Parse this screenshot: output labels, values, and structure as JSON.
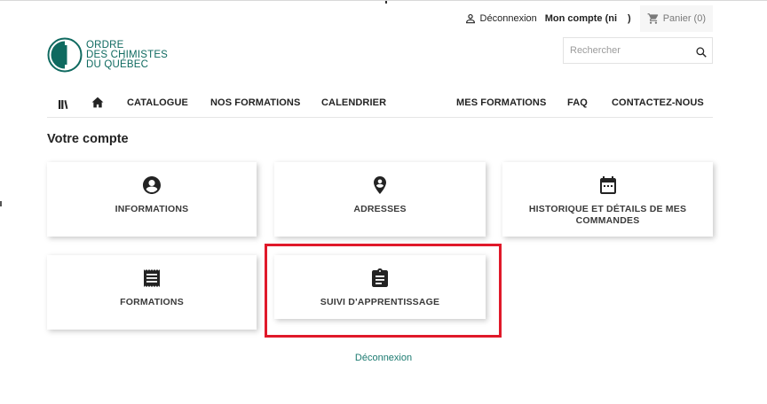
{
  "header": {
    "logout_label": "Déconnexion",
    "account_label": "Mon compte (ni",
    "account_suffix": ")",
    "cart_label": "Panier (0)",
    "logo_lines": [
      "ORDRE",
      "DES CHIMISTES",
      "DU QUÉBEC"
    ]
  },
  "search": {
    "placeholder": "Rechercher"
  },
  "nav": {
    "items": [
      "CATALOGUE",
      "NOS FORMATIONS",
      "CALENDRIER",
      "MES FORMATIONS",
      "FAQ",
      "CONTACTEZ-NOUS"
    ],
    "icons": [
      "library-icon",
      "home-icon"
    ]
  },
  "page": {
    "title": "Votre compte",
    "cards": [
      {
        "label": "INFORMATIONS",
        "icon": "account-circle-icon"
      },
      {
        "label": "ADRESSES",
        "icon": "location-pin-icon"
      },
      {
        "label_line1": "HISTORIQUE ET DÉTAILS DE MES",
        "label_line2": "COMMANDES",
        "icon": "calendar-icon"
      },
      {
        "label": "FORMATIONS",
        "icon": "receipt-icon"
      },
      {
        "label": "SUIVI D'APPRENTISSAGE",
        "icon": "clipboard-icon"
      }
    ],
    "highlighted_card": "SUIVI D'APPRENTISSAGE",
    "footer_logout": "Déconnexion"
  },
  "colors": {
    "brand_teal": "#0f6a60",
    "link_teal": "#1b7a70",
    "highlight_red": "#e0192a",
    "text_dark": "#232323"
  }
}
